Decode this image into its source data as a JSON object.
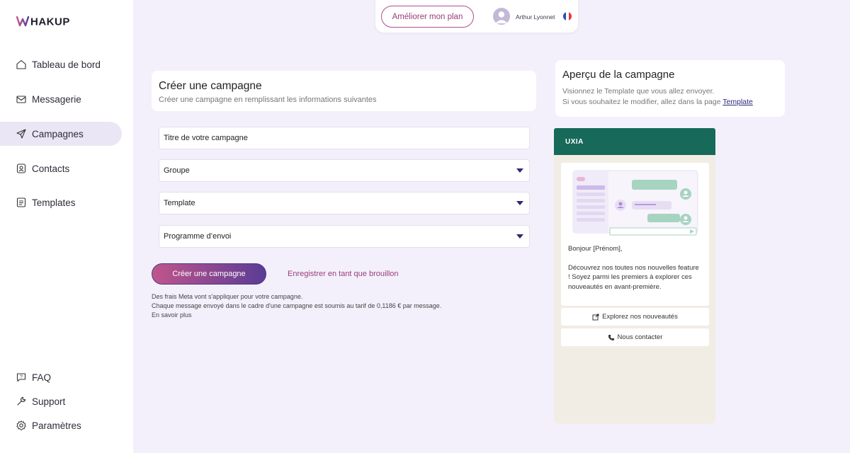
{
  "brand": {
    "logo_text": "WHAKUP"
  },
  "sidebar": {
    "items": [
      {
        "label": "Tableau de bord",
        "icon": "home-icon"
      },
      {
        "label": "Messagerie",
        "icon": "mail-icon"
      },
      {
        "label": "Campagnes",
        "icon": "send-icon",
        "active": true
      },
      {
        "label": "Contacts",
        "icon": "contact-icon"
      },
      {
        "label": "Templates",
        "icon": "template-icon"
      }
    ],
    "bottom_items": [
      {
        "label": "FAQ",
        "icon": "question-icon"
      },
      {
        "label": "Support",
        "icon": "wrench-icon"
      },
      {
        "label": "Paramètres",
        "icon": "gear-icon"
      }
    ]
  },
  "topbar": {
    "upgrade_label": "Améliorer mon plan",
    "user_name": "Arthur Lyonnet"
  },
  "form": {
    "title": "Créer une campagne",
    "subtitle": "Créer une campagne en remplissant les informations suivantes",
    "campaign_title_placeholder": "Titre de votre campagne",
    "group_label": "Groupe",
    "template_label": "Template",
    "schedule_label": "Programme d’envoi",
    "submit_label": "Créer une campagne",
    "draft_label": "Enregistrer en tant que brouillon",
    "disclaimer": [
      "Des frais Meta vont s'appliquer pour votre campagne.",
      "Chaque message envoyé dans le cadre d'une campagne est soumis au tarif de 0,1186 € par message.",
      "En savoir plus"
    ]
  },
  "preview": {
    "title": "Aperçu de la campagne",
    "line1": "Visionnez le Template que vous allez envoyer.",
    "line2_prefix": "Si vous souhaitez le modifier, allez dans la page ",
    "line2_link": "Template",
    "sender": "UXIA",
    "greeting": "Bonjour [Prénom],",
    "body": "Découvrez nos toutes nos nouvelles feature ! Soyez parmi les premiers à explorer ces nouveautés en avant-première.",
    "cta1": "Explorez nos nouveautés",
    "cta2": "Nous contacter"
  },
  "colors": {
    "accent": "#b44d8c",
    "primary_gradient_start": "#c1558c",
    "primary_gradient_end": "#5a3c95",
    "whatsapp_header": "#17695a",
    "page_bg": "#f3f0fc"
  }
}
